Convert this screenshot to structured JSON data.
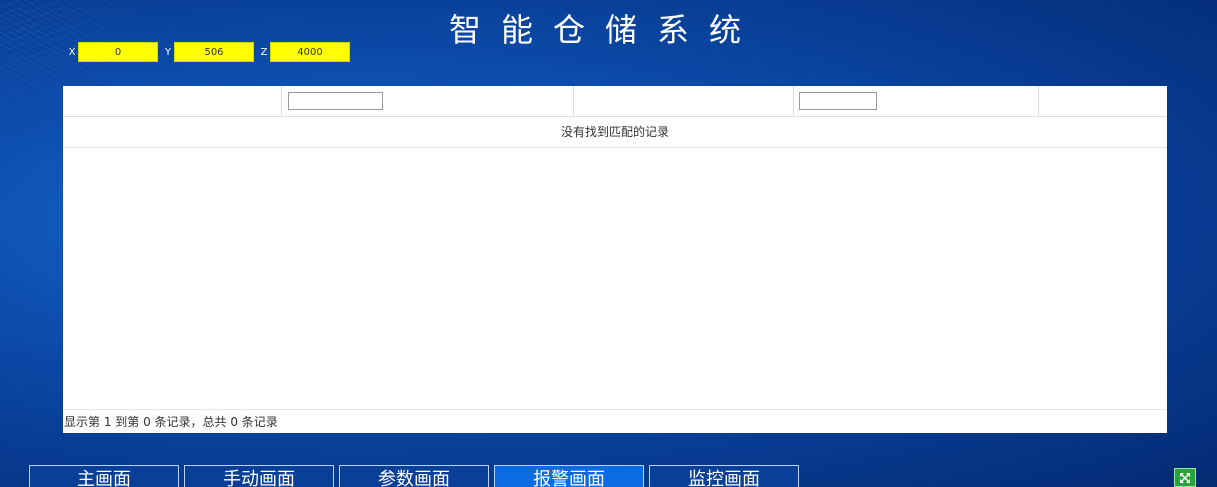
{
  "header": {
    "title": "智能仓储系统"
  },
  "coords": {
    "x_label": "X",
    "x_value": "0",
    "y_label": "Y",
    "y_value": "506",
    "z_label": "Z",
    "z_value": "4000"
  },
  "table": {
    "filters": [
      "",
      ""
    ],
    "empty_message": "没有找到匹配的记录",
    "footer": "显示第 1 到第 0 条记录，总共 0 条记录"
  },
  "nav": {
    "items": [
      {
        "label": "主画面",
        "active": false
      },
      {
        "label": "手动画面",
        "active": false
      },
      {
        "label": "参数画面",
        "active": false
      },
      {
        "label": "报警画面",
        "active": true
      },
      {
        "label": "监控画面",
        "active": false
      }
    ]
  },
  "fullscreen": {
    "icon": "expand-icon",
    "color": "#2aa33a"
  },
  "colors": {
    "accent": "#ffff00",
    "background": "#0d4fb0",
    "active_tab": "#0c6be3"
  }
}
